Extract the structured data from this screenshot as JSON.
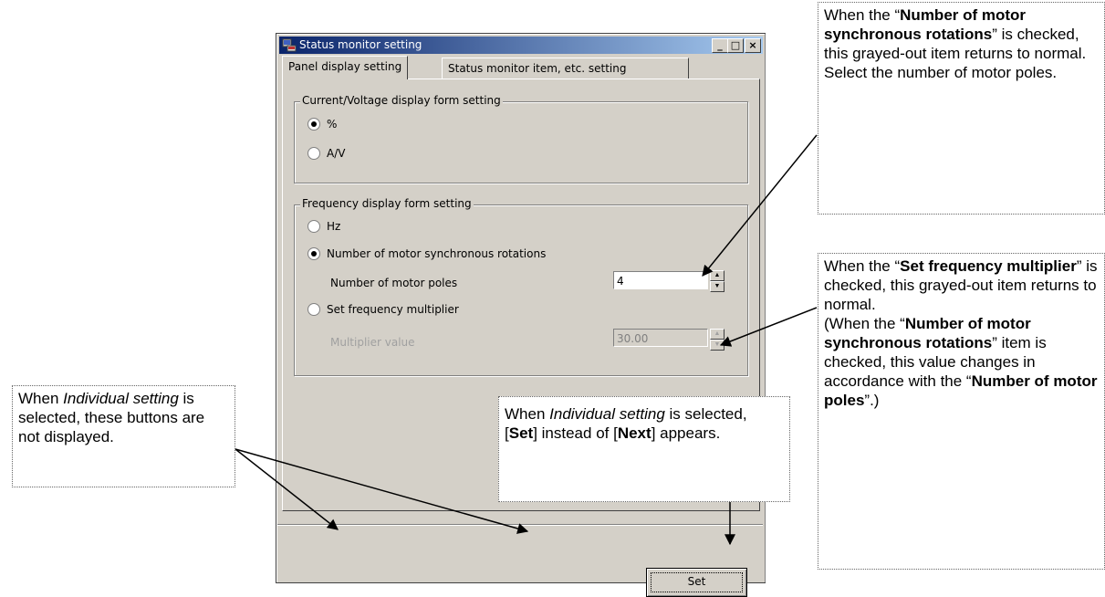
{
  "window": {
    "title": "Status monitor setting",
    "buttons": {
      "minimize": "_",
      "maximize": "□",
      "close": "×"
    }
  },
  "tabs": [
    {
      "label": "Panel display setting",
      "active": true
    },
    {
      "label": "Status monitor item, etc. setting",
      "active": false
    }
  ],
  "current_voltage_group": {
    "label": "Current/Voltage display form setting",
    "options": [
      {
        "label": "%",
        "selected": true
      },
      {
        "label": "A/V",
        "selected": false
      }
    ]
  },
  "frequency_group": {
    "label": "Frequency display form setting",
    "options": [
      {
        "label": "Hz",
        "selected": false
      },
      {
        "label": "Number of motor synchronous rotations",
        "selected": true
      },
      {
        "label": "Set frequency multiplier",
        "selected": false
      }
    ],
    "motor_poles": {
      "label": "Number of motor poles",
      "value": "4"
    },
    "multiplier": {
      "label": "Multiplier value",
      "value": "30.00",
      "disabled": true
    }
  },
  "set_button": "Set",
  "callouts": {
    "top_right": {
      "p1": "When the “",
      "b1": "Number of motor synchronous rotations",
      "p2": "” is checked, this grayed-out item returns to normal.",
      "p3": "Select the number of motor poles."
    },
    "mid_right": {
      "p1": "When the “",
      "b1": "Set frequency multiplier",
      "p2": "” is checked, this grayed-out item returns to normal.",
      "p3": "(When the “",
      "b2": "Number of motor synchronous rotations",
      "p4": "” item is checked, this value changes in accordance with the “",
      "b3": "Number of motor poles",
      "p5": "”.)"
    },
    "left": {
      "p1": "When ",
      "i1": "Individual setting",
      "p2": " is selected, these buttons are not displayed."
    },
    "center": {
      "p1": "When ",
      "i1": "Individual setting",
      "p2": " is selected, [",
      "b1": "Set",
      "p3": "] instead of [",
      "b2": "Next",
      "p4": "] appears."
    }
  }
}
